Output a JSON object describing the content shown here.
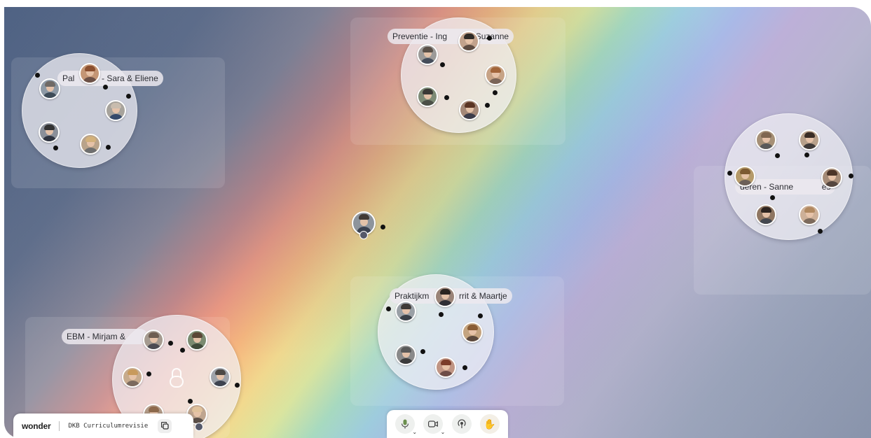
{
  "canvas": {
    "rooms": [
      {
        "id": "pal",
        "label": "Pal",
        "label_tail": "- Sara & Eliene"
      },
      {
        "id": "preventie",
        "label": "Preventie - Ing",
        "label_tail": "Suzanne"
      },
      {
        "id": "onderen",
        "label": "deren - Sanne",
        "label_tail": "es"
      },
      {
        "id": "praktijk",
        "label": "Praktijkm",
        "label_tail": "rrit & Maartje"
      },
      {
        "id": "ebm",
        "label": "EBM - Mirjam &",
        "label_tail": ""
      }
    ]
  },
  "brand": {
    "logo": "wonder",
    "room_name": "DKB Curriculumrevisie",
    "copy_icon": "copy-icon"
  },
  "controls": {
    "microphone": "microphone-icon",
    "camera": "camera-icon",
    "broadcast": "broadcast-icon",
    "raise_hand": "raise-hand-icon"
  },
  "colors": {
    "room_fill": "#f0eef4",
    "avatar_border": "#ffffff",
    "dot": "#111111"
  }
}
